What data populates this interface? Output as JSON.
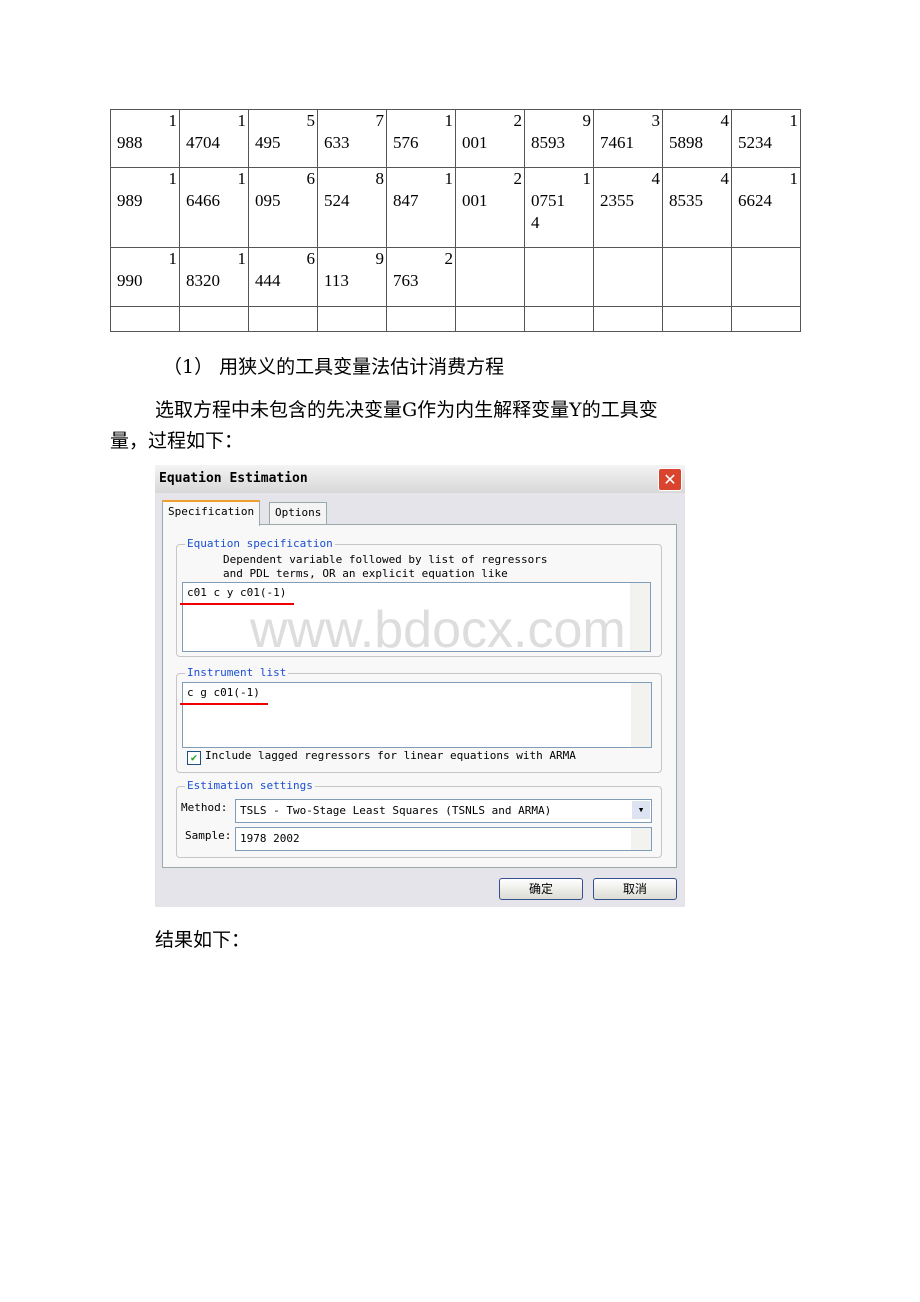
{
  "table": {
    "rows": [
      [
        [
          "1",
          "988"
        ],
        [
          "1",
          "4704"
        ],
        [
          "5",
          "495"
        ],
        [
          "7",
          "633"
        ],
        [
          "1",
          "576"
        ],
        [
          "2",
          "001"
        ],
        [
          "9",
          "8593"
        ],
        [
          "3",
          "7461"
        ],
        [
          "4",
          "5898"
        ],
        [
          "1",
          "5234"
        ]
      ],
      [
        [
          "1",
          "989"
        ],
        [
          "1",
          "6466"
        ],
        [
          "6",
          "095"
        ],
        [
          "8",
          "524"
        ],
        [
          "1",
          "847"
        ],
        [
          "2",
          "001"
        ],
        [
          "1",
          "0751",
          "4"
        ],
        [
          "4",
          "2355"
        ],
        [
          "4",
          "8535"
        ],
        [
          "1",
          "6624"
        ]
      ],
      [
        [
          "1",
          "990"
        ],
        [
          "1",
          "8320"
        ],
        [
          "6",
          "444"
        ],
        [
          "9",
          "113"
        ],
        [
          "2",
          "763"
        ],
        [],
        [],
        [],
        [],
        []
      ],
      [
        [],
        [],
        [],
        [],
        [],
        [],
        [],
        [],
        [],
        []
      ]
    ]
  },
  "heading": "（1） 用狭义的工具变量法估计消费方程",
  "para_line1": "选取方程中未包含的先决变量G作为内生解释变量Y的工具变",
  "para_line2": "量，过程如下：",
  "dialog": {
    "title": "Equation Estimation",
    "tabs": [
      "Specification",
      "Options"
    ],
    "eq_group": "Equation specification",
    "eq_help1": "Dependent variable followed by list of regressors",
    "eq_help2": "and PDL terms, OR an explicit equation like",
    "eq_value": "c01 c y c01(-1)",
    "inst_group": "Instrument list",
    "inst_value": "c g c01(-1)",
    "checkbox_label": "Include lagged regressors for linear equations with ARMA",
    "checkbox_checked": true,
    "est_group": "Estimation settings",
    "method_label": "Method:",
    "method_value": "TSLS  -  Two-Stage Least Squares (TSNLS and ARMA)",
    "sample_label": "Sample:",
    "sample_value": "1978 2002",
    "ok": "确定",
    "cancel": "取消"
  },
  "watermark": "www.bdocx.com",
  "result_text": "结果如下："
}
